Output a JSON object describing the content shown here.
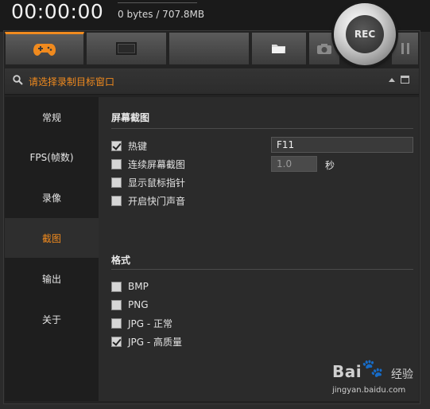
{
  "header": {
    "timer": "00:00:00",
    "storage": "0 bytes / 707.8MB"
  },
  "tabs": [
    {
      "id": "game",
      "icon": "gamepad-icon"
    },
    {
      "id": "screen",
      "icon": "monitor-icon"
    },
    {
      "id": "blank",
      "icon": ""
    },
    {
      "id": "folder",
      "icon": "folder-icon"
    },
    {
      "id": "camera",
      "icon": "camera-icon"
    },
    {
      "id": "pause",
      "icon": "pause-icon"
    }
  ],
  "rec_label": "REC",
  "target_window": {
    "label": "请选择录制目标窗口"
  },
  "sidebar": {
    "items": [
      {
        "label": "常规"
      },
      {
        "label": "FPS(帧数)"
      },
      {
        "label": "录像"
      },
      {
        "label": "截图"
      },
      {
        "label": "输出"
      },
      {
        "label": "关于"
      }
    ],
    "active_index": 3
  },
  "screenshot_section": {
    "title": "屏幕截图",
    "hotkey": {
      "label": "热键",
      "checked": true,
      "value": "F11"
    },
    "continuous": {
      "label": "连续屏幕截图",
      "checked": false,
      "value": "1.0",
      "unit": "秒"
    },
    "show_cursor": {
      "label": "显示鼠标指针",
      "checked": false
    },
    "shutter_sound": {
      "label": "开启快门声音",
      "checked": false
    }
  },
  "format_section": {
    "title": "格式",
    "options": [
      {
        "label": "BMP",
        "checked": false
      },
      {
        "label": "PNG",
        "checked": false
      },
      {
        "label": "JPG - 正常",
        "checked": false
      },
      {
        "label": "JPG - 高质量",
        "checked": true
      }
    ]
  },
  "watermark": {
    "logo_text": "Bai",
    "logo_paw": "🐾",
    "logo_suffix": "经验",
    "url": "jingyan.baidu.com"
  },
  "colors": {
    "accent": "#f08a1e",
    "background": "#2b2b2b",
    "sidebar": "#1e1e1e"
  }
}
